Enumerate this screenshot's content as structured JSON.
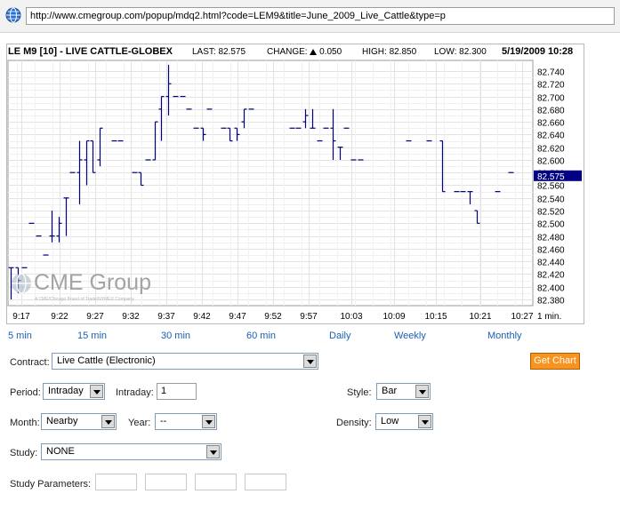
{
  "browser": {
    "url": "http://www.cmegroup.com/popup/mdq2.html?code=LEM9&title=June_2009_Live_Cattle&type=p",
    "globe_icon": "globe-icon"
  },
  "chart_header": {
    "symbol": "LE M9 [10] - LIVE CATTLE-GLOBEX",
    "last_label": "LAST:",
    "last_value": "82.575",
    "change_label": "CHANGE:",
    "change_value": "0.050",
    "high_label": "HIGH:",
    "high_value": "82.850",
    "low_label": "LOW:",
    "low_value": "82.300",
    "datetime": "5/19/2009 10:28",
    "change_icon": "up-triangle-icon"
  },
  "watermark": {
    "brand": "CME Group",
    "subtext": "A CME/Chicago Board of Trade/NYMEX Company"
  },
  "chart_data": {
    "type": "bar",
    "subtype": "ohlc",
    "interval_label": "1 min.",
    "x_tick_labels": [
      "9:17",
      "9:22",
      "9:27",
      "9:32",
      "9:37",
      "9:42",
      "9:47",
      "9:52",
      "9:57",
      "10:03",
      "10:09",
      "10:15",
      "10:21",
      "10:27"
    ],
    "y_tick_labels": [
      "82.740",
      "82.720",
      "82.700",
      "82.680",
      "82.660",
      "82.640",
      "82.620",
      "82.600",
      "82.580",
      "82.560",
      "82.540",
      "82.520",
      "82.500",
      "82.480",
      "82.460",
      "82.440",
      "82.420",
      "82.400",
      "82.380"
    ],
    "ylim": [
      82.37,
      82.75
    ],
    "last_marker": "82.575",
    "grid": true,
    "bar_color": "#000080",
    "marker_color": "#000080",
    "bars": [
      {
        "t": 0,
        "o": 82.43,
        "h": 82.43,
        "l": 82.38,
        "c": 82.43
      },
      {
        "t": 1,
        "o": 82.43,
        "h": 82.43,
        "l": 82.39,
        "c": 82.41
      },
      {
        "t": 2,
        "o": 82.43,
        "h": 82.43,
        "l": 82.43,
        "c": 82.43
      },
      {
        "t": 3,
        "o": 82.5,
        "h": 82.5,
        "l": 82.5,
        "c": 82.5
      },
      {
        "t": 4,
        "o": 82.48,
        "h": 82.48,
        "l": 82.48,
        "c": 82.48
      },
      {
        "t": 5,
        "o": 82.45,
        "h": 82.45,
        "l": 82.45,
        "c": 82.45
      },
      {
        "t": 6,
        "o": 82.48,
        "h": 82.52,
        "l": 82.47,
        "c": 82.48
      },
      {
        "t": 7,
        "o": 82.48,
        "h": 82.51,
        "l": 82.47,
        "c": 82.5
      },
      {
        "t": 8,
        "o": 82.54,
        "h": 82.54,
        "l": 82.48,
        "c": 82.54
      },
      {
        "t": 9,
        "o": 82.58,
        "h": 82.58,
        "l": 82.58,
        "c": 82.58
      },
      {
        "t": 10,
        "o": 82.58,
        "h": 82.63,
        "l": 82.53,
        "c": 82.6
      },
      {
        "t": 11,
        "o": 82.6,
        "h": 82.63,
        "l": 82.56,
        "c": 82.63
      },
      {
        "t": 12,
        "o": 82.63,
        "h": 82.63,
        "l": 82.58,
        "c": 82.58
      },
      {
        "t": 13,
        "o": 82.6,
        "h": 82.65,
        "l": 82.59,
        "c": 82.65
      },
      {
        "t": 15,
        "o": 82.63,
        "h": 82.63,
        "l": 82.63,
        "c": 82.63
      },
      {
        "t": 16,
        "o": 82.63,
        "h": 82.63,
        "l": 82.63,
        "c": 82.63
      },
      {
        "t": 18,
        "o": 82.58,
        "h": 82.58,
        "l": 82.58,
        "c": 82.58
      },
      {
        "t": 19,
        "o": 82.58,
        "h": 82.58,
        "l": 82.56,
        "c": 82.56
      },
      {
        "t": 20,
        "o": 82.6,
        "h": 82.6,
        "l": 82.6,
        "c": 82.6
      },
      {
        "t": 21,
        "o": 82.6,
        "h": 82.66,
        "l": 82.6,
        "c": 82.66
      },
      {
        "t": 22,
        "o": 82.68,
        "h": 82.7,
        "l": 82.63,
        "c": 82.7
      },
      {
        "t": 23,
        "o": 82.7,
        "h": 82.75,
        "l": 82.67,
        "c": 82.72
      },
      {
        "t": 24,
        "o": 82.7,
        "h": 82.7,
        "l": 82.7,
        "c": 82.7
      },
      {
        "t": 25,
        "o": 82.7,
        "h": 82.7,
        "l": 82.7,
        "c": 82.7
      },
      {
        "t": 26,
        "o": 82.68,
        "h": 82.68,
        "l": 82.68,
        "c": 82.68
      },
      {
        "t": 27,
        "o": 82.65,
        "h": 82.65,
        "l": 82.65,
        "c": 82.65
      },
      {
        "t": 28,
        "o": 82.65,
        "h": 82.65,
        "l": 82.63,
        "c": 82.64
      },
      {
        "t": 29,
        "o": 82.68,
        "h": 82.68,
        "l": 82.68,
        "c": 82.68
      },
      {
        "t": 31,
        "o": 82.65,
        "h": 82.65,
        "l": 82.65,
        "c": 82.65
      },
      {
        "t": 32,
        "o": 82.65,
        "h": 82.65,
        "l": 82.63,
        "c": 82.63
      },
      {
        "t": 33,
        "o": 82.65,
        "h": 82.65,
        "l": 82.63,
        "c": 82.64
      },
      {
        "t": 34,
        "o": 82.66,
        "h": 82.68,
        "l": 82.65,
        "c": 82.68
      },
      {
        "t": 35,
        "o": 82.68,
        "h": 82.68,
        "l": 82.68,
        "c": 82.68
      },
      {
        "t": 41,
        "o": 82.65,
        "h": 82.65,
        "l": 82.65,
        "c": 82.65
      },
      {
        "t": 42,
        "o": 82.65,
        "h": 82.65,
        "l": 82.65,
        "c": 82.65
      },
      {
        "t": 43,
        "o": 82.66,
        "h": 82.68,
        "l": 82.65,
        "c": 82.67
      },
      {
        "t": 44,
        "o": 82.65,
        "h": 82.68,
        "l": 82.65,
        "c": 82.65
      },
      {
        "t": 45,
        "o": 82.63,
        "h": 82.63,
        "l": 82.63,
        "c": 82.63
      },
      {
        "t": 46,
        "o": 82.65,
        "h": 82.65,
        "l": 82.65,
        "c": 82.65
      },
      {
        "t": 47,
        "o": 82.65,
        "h": 82.68,
        "l": 82.6,
        "c": 82.63
      },
      {
        "t": 48,
        "o": 82.62,
        "h": 82.62,
        "l": 82.6,
        "c": 82.62
      },
      {
        "t": 49,
        "o": 82.65,
        "h": 82.65,
        "l": 82.65,
        "c": 82.65
      },
      {
        "t": 50,
        "o": 82.6,
        "h": 82.6,
        "l": 82.6,
        "c": 82.6
      },
      {
        "t": 51,
        "o": 82.6,
        "h": 82.6,
        "l": 82.6,
        "c": 82.6
      },
      {
        "t": 58,
        "o": 82.63,
        "h": 82.63,
        "l": 82.63,
        "c": 82.63
      },
      {
        "t": 61,
        "o": 82.63,
        "h": 82.63,
        "l": 82.63,
        "c": 82.63
      },
      {
        "t": 63,
        "o": 82.63,
        "h": 82.63,
        "l": 82.55,
        "c": 82.55
      },
      {
        "t": 65,
        "o": 82.55,
        "h": 82.55,
        "l": 82.55,
        "c": 82.55
      },
      {
        "t": 66,
        "o": 82.55,
        "h": 82.55,
        "l": 82.55,
        "c": 82.55
      },
      {
        "t": 67,
        "o": 82.55,
        "h": 82.55,
        "l": 82.53,
        "c": 82.55
      },
      {
        "t": 68,
        "o": 82.52,
        "h": 82.52,
        "l": 82.5,
        "c": 82.5
      },
      {
        "t": 71,
        "o": 82.55,
        "h": 82.55,
        "l": 82.55,
        "c": 82.55
      },
      {
        "t": 73,
        "o": 82.58,
        "h": 82.58,
        "l": 82.58,
        "c": 82.58
      }
    ]
  },
  "periods": [
    "5 min",
    "15 min",
    "30 min",
    "60 min",
    "Daily",
    "Weekly",
    "Monthly"
  ],
  "form": {
    "contract_label": "Contract:",
    "contract_value": "Live Cattle (Electronic)",
    "get_chart": "Get Chart",
    "period_label": "Period:",
    "period_value": "Intraday",
    "intraday_label": "Intraday:",
    "intraday_value": "1",
    "style_label": "Style:",
    "style_value": "Bar",
    "month_label": "Month:",
    "month_value": "Nearby",
    "year_label": "Year:",
    "year_value": "--",
    "density_label": "Density:",
    "density_value": "Low",
    "study_label": "Study:",
    "study_value": "NONE",
    "study_params_label": "Study Parameters:"
  }
}
